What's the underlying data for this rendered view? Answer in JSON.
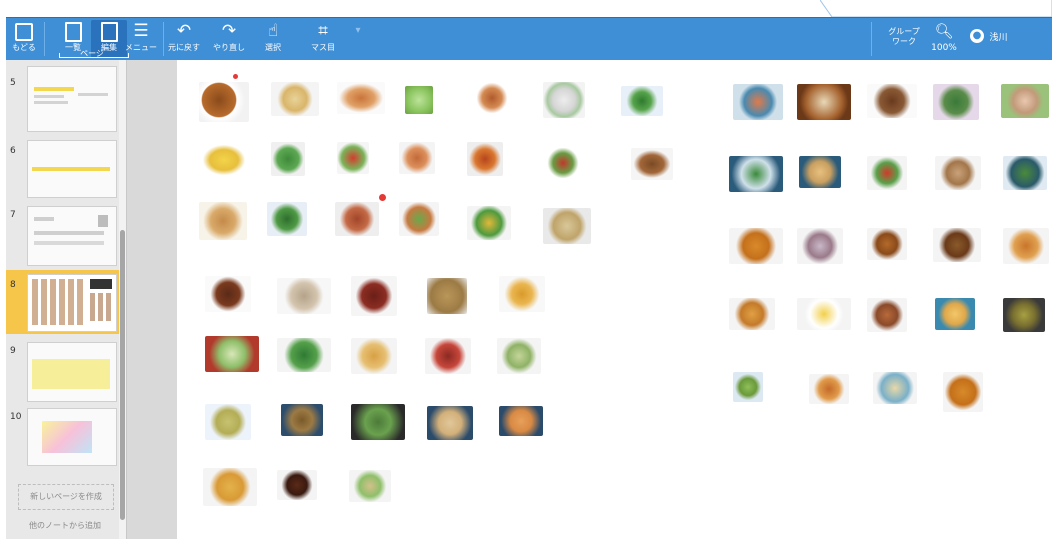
{
  "toolbar": {
    "back": "もどる",
    "list": "一覧",
    "edit": "編集",
    "page_group": "ページ",
    "menu": "メニュー",
    "undo": "元に戻す",
    "redo": "やり直し",
    "select": "選択",
    "grid": "マス目",
    "group_work": "グループ\nワーク",
    "zoom": "100%",
    "user": "浅川"
  },
  "sidebar": {
    "pages": [
      "5",
      "6",
      "7",
      "8",
      "9",
      "10"
    ],
    "add_page": "新しいページを作成",
    "from_other": "他のノートから追加"
  },
  "colors": {
    "toolbar": "#3f8fd6",
    "selected_page": "#f5c64a",
    "dot_red": "#e53935",
    "dot_green": "#2e9d3b"
  }
}
